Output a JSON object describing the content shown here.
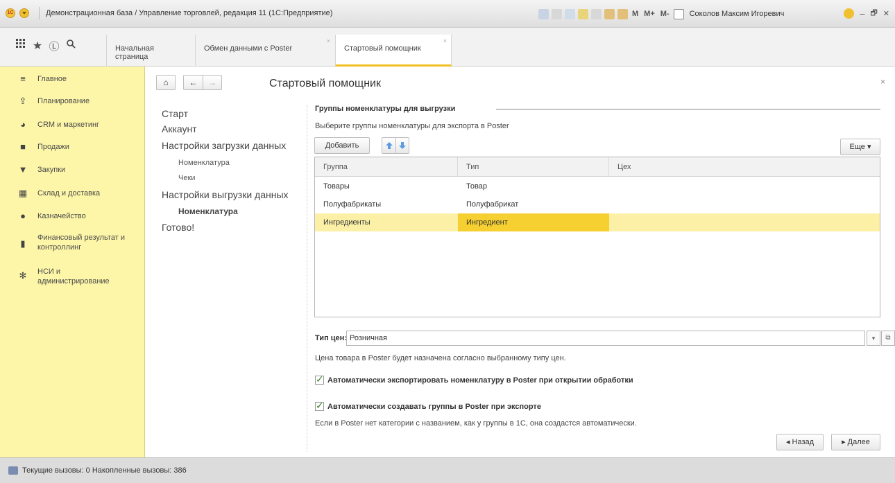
{
  "window": {
    "title": "Демонстрационная база / Управление торговлей, редакция 11  (1С:Предприятие)",
    "logo_text": "1С",
    "tools_m": "M",
    "tools_mplus": "M+",
    "tools_mminus": "M-",
    "user": "Соколов Максим Игоревич",
    "minimize": "–",
    "restore": "🗗",
    "close": "✕"
  },
  "tabs": [
    {
      "label": "Начальная страница"
    },
    {
      "label": "Обмен данными с Poster"
    },
    {
      "label": "Стартовый помощник"
    }
  ],
  "sidebar": {
    "items": [
      {
        "label": "Главное",
        "icon": "menu-icon"
      },
      {
        "label": "Планирование",
        "icon": "planning-icon"
      },
      {
        "label": "CRM и маркетинг",
        "icon": "pie-chart-icon"
      },
      {
        "label": "Продажи",
        "icon": "bag-icon"
      },
      {
        "label": "Закупки",
        "icon": "cart-icon"
      },
      {
        "label": "Склад и доставка",
        "icon": "warehouse-icon"
      },
      {
        "label": "Казначейство",
        "icon": "coin-icon"
      },
      {
        "label": "Финансовый результат и контроллинг",
        "icon": "bar-chart-icon"
      },
      {
        "label": "НСИ и администрирование",
        "icon": "gear-icon"
      }
    ]
  },
  "page": {
    "title": "Стартовый помощник",
    "home": "⌂",
    "back": "←",
    "forward": "→",
    "close": "×"
  },
  "steps": {
    "start": "Старт",
    "account": "Аккаунт",
    "load_settings": "Настройки загрузки данных",
    "load_nomenclature": "Номенклатура",
    "load_checks": "Чеки",
    "export_settings": "Настройки выгрузки данных",
    "export_nomenclature": "Номенклатура",
    "done": "Готово!"
  },
  "section": {
    "heading": "Группы номенклатуры для выгрузки",
    "description": "Выберите группы номенклатуры для экспорта в Poster",
    "add_button": "Добавить",
    "more_button": "Еще ▾"
  },
  "table": {
    "headers": {
      "group": "Группа",
      "type": "Тип",
      "shop": "Цех"
    },
    "rows": [
      {
        "group": "Товары",
        "type": "Товар",
        "shop": ""
      },
      {
        "group": "Полуфабрикаты",
        "type": "Полуфабрикат",
        "shop": ""
      },
      {
        "group": "Ингредиенты",
        "type": "Ингредиент",
        "shop": ""
      }
    ],
    "selected_row": 2
  },
  "price": {
    "label": "Тип цен:",
    "value": "Розничная",
    "note": "Цена товара в Poster будет назначена согласно выбранному типу цен."
  },
  "options": {
    "auto_export": {
      "label": "Автоматически экспортировать номенклатуру в Poster при открытии обработки",
      "checked": true
    },
    "auto_groups": {
      "label": "Автоматически создавать группы в Poster при экспорте",
      "checked": true
    },
    "groups_note": "Если в Poster нет категории с названием, как у группы в 1С, она создастся автоматически."
  },
  "footer": {
    "back": "◂ Назад",
    "next": "▸ Далее"
  },
  "status": {
    "text": "Текущие вызовы: 0   Накопленные вызовы: 386"
  },
  "colors": {
    "sidebar_bg": "#fdf6a8",
    "selected_row": "#fbf0a6",
    "selected_cell": "#f6cf30",
    "active_tab_underline": "#f0c020"
  }
}
